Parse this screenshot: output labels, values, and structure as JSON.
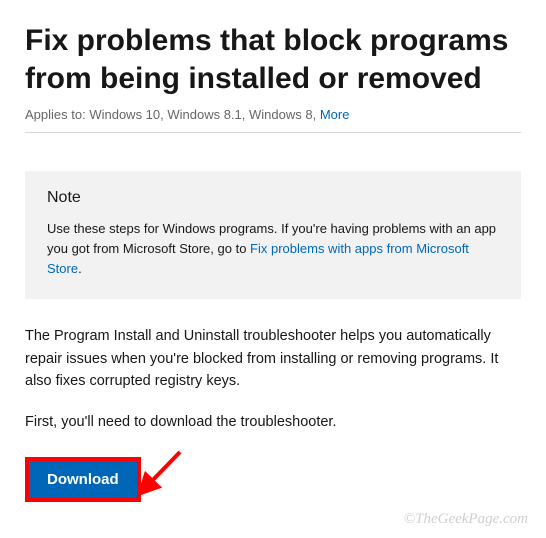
{
  "header": {
    "title": "Fix problems that block programs from being installed or removed",
    "applies_label": "Applies to: ",
    "applies_list": "Windows 10, Windows 8.1, Windows 8, ",
    "more_label": "More"
  },
  "note": {
    "title": "Note",
    "text_before": "Use these steps for Windows programs. If you're having problems with an app you got from Microsoft Store, go to ",
    "link_text": "Fix problems with apps from Microsoft Store",
    "text_after": "."
  },
  "body": {
    "para1": "The Program Install and Uninstall troubleshooter helps you automatically repair issues when you're blocked from installing or removing programs. It also fixes corrupted registry keys.",
    "para2": "First, you'll need to download the troubleshooter."
  },
  "download": {
    "label": "Download"
  },
  "watermark": "©TheGeekPage.com"
}
